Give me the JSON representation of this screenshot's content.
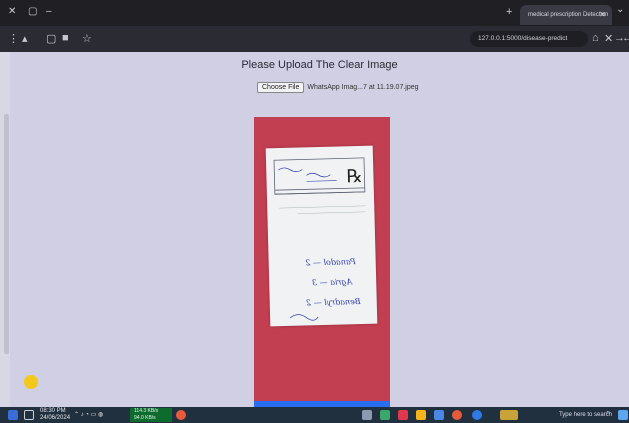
{
  "browser": {
    "tab_title": "medical prescription Detection",
    "url": "127.0.0.1:5000/disease-predict"
  },
  "page": {
    "heading": "Please Upload The Clear Image",
    "choose_file_label": "Choose File",
    "file_name": "WhatsApp Imag...7 at 11.19.07.jpeg",
    "prescription_lines": [
      "Panadol — 2",
      "Agria — 3",
      "Benadryl — 2"
    ]
  },
  "taskbar": {
    "search_placeholder": "Type here to search",
    "time": "08:30 PM",
    "date": "24/06/2024",
    "net_up": "114.3 KB/s",
    "net_down": "94.0 KB/s"
  },
  "colors": {
    "page_bg": "#d0cfe4",
    "image_bg": "#c23f51",
    "accent": "#2a6ef0",
    "taskbar": "#20303e"
  }
}
